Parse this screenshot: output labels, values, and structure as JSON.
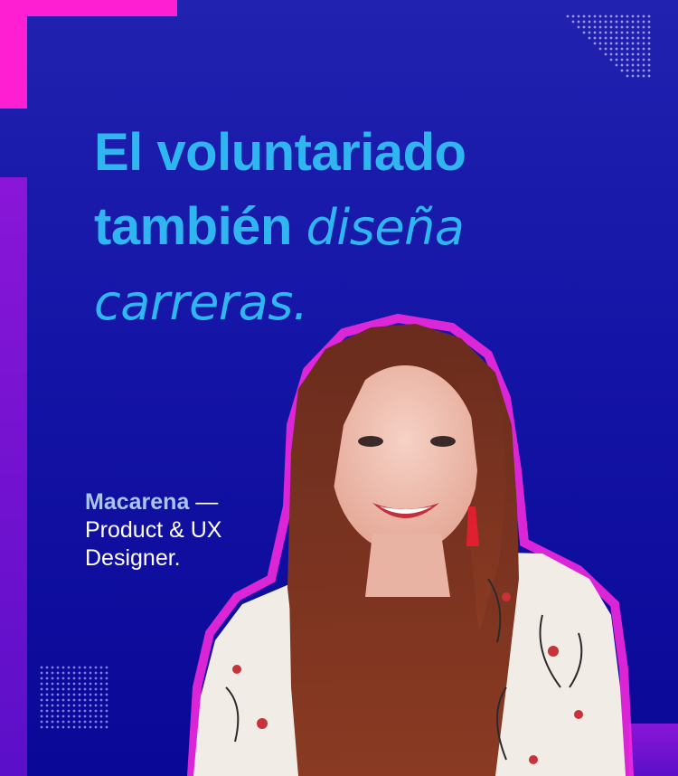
{
  "headline": {
    "line1": "El voluntariado",
    "line2_bold": "también",
    "line2_light": "diseña",
    "line3": "carreras."
  },
  "caption": {
    "name": "Macarena",
    "dash": " —",
    "role_line1": "Product & UX",
    "role_line2": "Designer."
  },
  "colors": {
    "background": "#1818a8",
    "accent_magenta": "#ff1fd2",
    "headline_cyan": "#2fb6f0",
    "left_bar_purple": "#7a14d2"
  },
  "icons": [
    "dot-grid-decoration",
    "dot-grid-decoration"
  ]
}
